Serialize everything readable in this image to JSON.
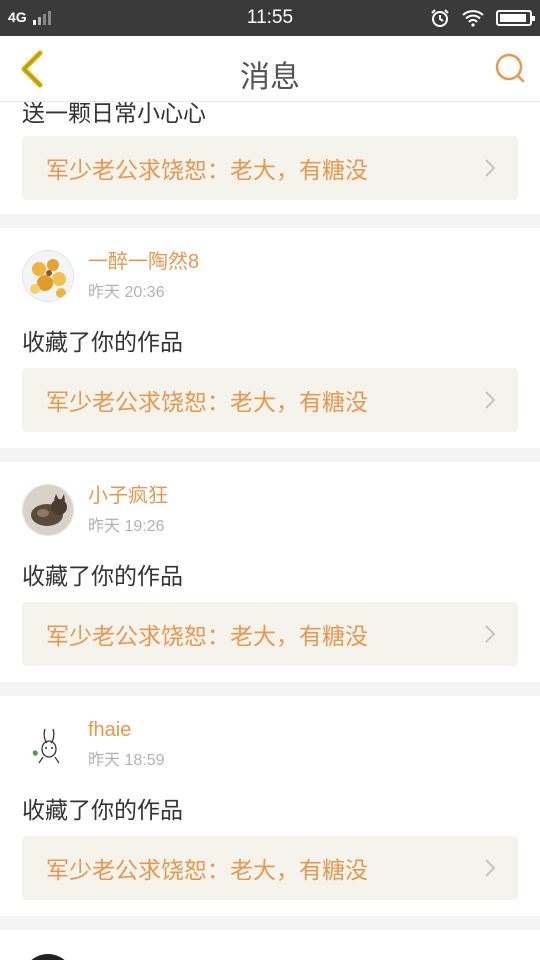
{
  "status_bar": {
    "network": "4G",
    "time": "11:55"
  },
  "header": {
    "title": "消息"
  },
  "feed": {
    "partial": {
      "text": "送一颗日常小心心",
      "ref_text": "军少老公求饶恕：老大，有糖没"
    },
    "items": [
      {
        "name": "一醉一陶然8",
        "time": "昨天 20:36",
        "text": "收藏了你的作品",
        "ref_text": "军少老公求饶恕：老大，有糖没"
      },
      {
        "name": "小子疯狂",
        "time": "昨天 19:26",
        "text": "收藏了你的作品",
        "ref_text": "军少老公求饶恕：老大，有糖没"
      },
      {
        "name": "fhaie",
        "time": "昨天 18:59",
        "text": "收藏了你的作品",
        "ref_text": "军少老公求饶恕：老大，有糖没"
      }
    ]
  },
  "colors": {
    "accent": "#e8974d",
    "back_icon": "#d6b000",
    "ref_bg": "#f4f4ec"
  }
}
